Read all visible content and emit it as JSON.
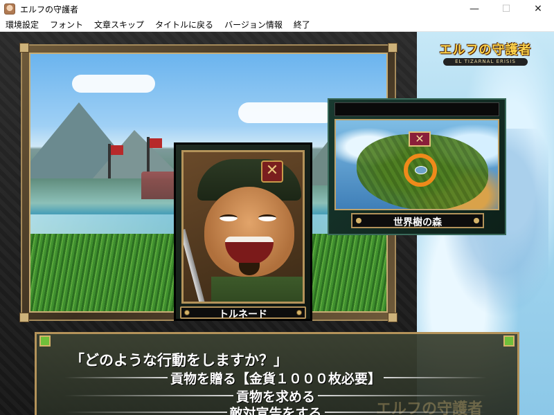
{
  "window": {
    "title": "エルフの守護者",
    "controls": {
      "minimize": "—",
      "maximize": "☐",
      "close": "✕"
    }
  },
  "menu": {
    "items": [
      "環境設定",
      "フォント",
      "文章スキップ",
      "タイトルに戻る",
      "バージョン情報",
      "終了"
    ]
  },
  "logo": {
    "title": "エルフの守護者",
    "subtitle": "EL TIZARNAL ERISIS"
  },
  "portrait": {
    "badge": "✕",
    "name": "トルネード"
  },
  "map": {
    "marker": "✕",
    "location": "世界樹の森"
  },
  "dialog": {
    "prompt": "「どのような行動をしますか？」",
    "choices": [
      "貢物を贈る【金貨１０００枚必要】",
      "貢物を求める",
      "敵対宣告をする"
    ],
    "watermark": "エルフの守護者"
  },
  "colors": {
    "frame_gold": "#b4935a",
    "dialog_bg": "#3c4232",
    "map_ring": "#f08a1a"
  }
}
